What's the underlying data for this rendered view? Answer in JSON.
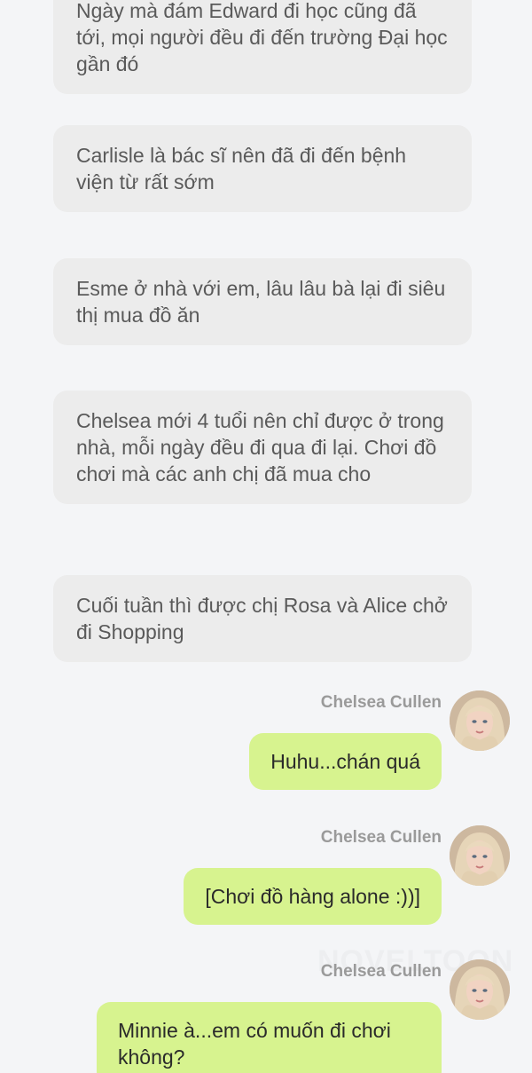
{
  "narrations": [
    "Ngày mà đám Edward đi học cũng đã tới, mọi người đều đi đến trường Đại học gần đó",
    "Carlisle là bác sĩ nên đã đi đến bệnh viện từ rất sớm",
    "Esme ở nhà với em, lâu lâu bà lại đi siêu thị mua đồ ăn",
    "Chelsea mới 4 tuổi nên chỉ được ở trong nhà, mỗi ngày đều đi qua đi lại. Chơi đồ chơi mà các anh chị đã mua cho",
    "Cuối tuần thì được chị Rosa và Alice chở đi Shopping"
  ],
  "messages": [
    {
      "speaker": "Chelsea Cullen",
      "text": "Huhu...chán quá",
      "avatar": "avatar-icon"
    },
    {
      "speaker": "Chelsea Cullen",
      "text": "[Chơi đồ hàng alone :))]",
      "avatar": "avatar-icon"
    },
    {
      "speaker": "Chelsea Cullen",
      "text": "Minnie à...em có muốn đi chơi không?",
      "avatar": "avatar-icon"
    }
  ],
  "watermark": "NOVELTOON",
  "colors": {
    "background": "#f4f5f7",
    "narration_bubble": "#ececec",
    "message_bubble": "#d7f38f"
  }
}
